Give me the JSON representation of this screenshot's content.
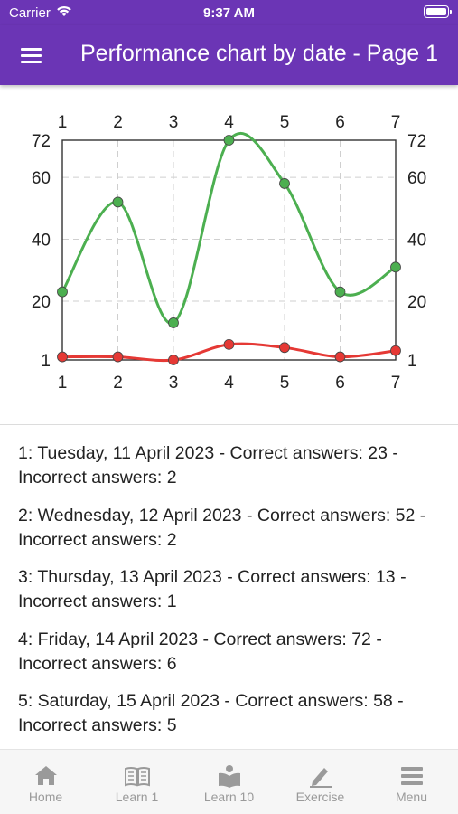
{
  "status_bar": {
    "carrier": "Carrier",
    "time": "9:37 AM"
  },
  "app_bar": {
    "title": "Performance chart by date - Page 1"
  },
  "chart_data": {
    "type": "line",
    "x": [
      1,
      2,
      3,
      4,
      5,
      6,
      7
    ],
    "x_tick_labels": [
      "1",
      "2",
      "3",
      "4",
      "5",
      "6",
      "7"
    ],
    "y_tick_labels": [
      "1",
      "20",
      "40",
      "60",
      "72"
    ],
    "ylim": [
      1,
      72
    ],
    "grid": true,
    "legend": "none",
    "series": [
      {
        "values": [
          23,
          52,
          13,
          72,
          58,
          23,
          31
        ],
        "color": "#4caf50"
      },
      {
        "values": [
          2,
          2,
          1,
          6,
          5,
          2,
          4
        ],
        "color": "#e53935"
      }
    ]
  },
  "entries": [
    {
      "line1": "1: Tuesday, 11 April 2023 - Correct answers: 23 -",
      "line2": "Incorrect answers: 2"
    },
    {
      "line1": "2: Wednesday, 12 April 2023 - Correct answers: 52 -",
      "line2": "Incorrect answers: 2"
    },
    {
      "line1": "3: Thursday, 13 April 2023 - Correct answers: 13 -",
      "line2": "Incorrect answers: 1"
    },
    {
      "line1": "4: Friday, 14 April 2023 - Correct answers: 72 -",
      "line2": "Incorrect answers: 6"
    },
    {
      "line1": "5: Saturday, 15 April 2023 - Correct answers: 58 -",
      "line2": "Incorrect answers: 5"
    }
  ],
  "tab_bar": {
    "tabs": [
      {
        "label": "Home",
        "icon": "home-icon"
      },
      {
        "label": "Learn 1",
        "icon": "book-icon"
      },
      {
        "label": "Learn 10",
        "icon": "reader-icon"
      },
      {
        "label": "Exercise",
        "icon": "pencil-icon"
      },
      {
        "label": "Menu",
        "icon": "menu-icon"
      }
    ]
  },
  "colors": {
    "primary": "#6b35b5",
    "correct": "#4caf50",
    "incorrect": "#e53935",
    "tab_icon": "#9a9a9a"
  }
}
